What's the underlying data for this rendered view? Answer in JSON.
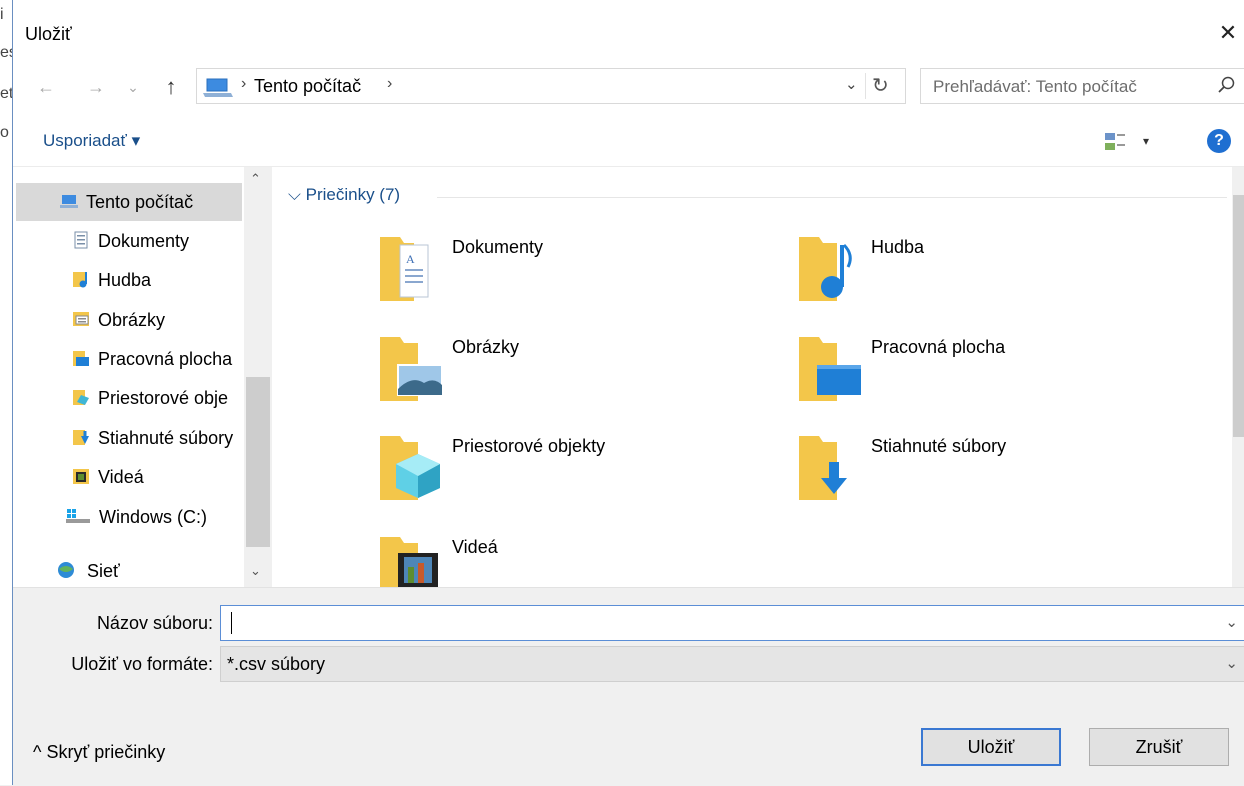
{
  "background_letters": [
    "i",
    "es",
    "et",
    "o"
  ],
  "dialog": {
    "title": "Uložiť",
    "close_glyph": "✕"
  },
  "nav": {
    "back_glyph": "←",
    "forward_glyph": "→",
    "recent_glyph": "⌄",
    "up_glyph": "↑",
    "address_crumb": "Tento počítač",
    "crumb_sep": "›",
    "address_dropdown": "⌄",
    "refresh_glyph": "↻",
    "search_placeholder": "Prehľadávať: Tento počítač"
  },
  "toolbar": {
    "organize_label": "Usporiadať ▾",
    "view_dropdown": "▾",
    "help_glyph": "?"
  },
  "sidebar": {
    "items": [
      {
        "label": "Tento počítač",
        "icon": "computer-icon"
      },
      {
        "label": "Dokumenty",
        "icon": "documents-icon"
      },
      {
        "label": "Hudba",
        "icon": "music-icon"
      },
      {
        "label": "Obrázky",
        "icon": "pictures-icon"
      },
      {
        "label": "Pracovná plocha",
        "icon": "desktop-icon"
      },
      {
        "label": "Priestorové obje",
        "icon": "3d-objects-icon"
      },
      {
        "label": "Stiahnuté súbory",
        "icon": "downloads-icon"
      },
      {
        "label": "Videá",
        "icon": "videos-icon"
      },
      {
        "label": "Windows (C:)",
        "icon": "drive-icon"
      },
      {
        "label": "Sieť",
        "icon": "network-icon"
      }
    ],
    "scroll_up": "⌃",
    "scroll_down": "⌄"
  },
  "content": {
    "group_header": "⌵  Priečinky (7)",
    "folders": [
      {
        "label": "Dokumenty",
        "icon": "documents-folder-icon"
      },
      {
        "label": "Hudba",
        "icon": "music-folder-icon"
      },
      {
        "label": "Obrázky",
        "icon": "pictures-folder-icon"
      },
      {
        "label": "Pracovná plocha",
        "icon": "desktop-folder-icon"
      },
      {
        "label": "Priestorové objekty",
        "icon": "3d-objects-folder-icon"
      },
      {
        "label": "Stiahnuté súbory",
        "icon": "downloads-folder-icon"
      },
      {
        "label": "Videá",
        "icon": "videos-folder-icon"
      }
    ]
  },
  "form": {
    "filename_label": "Názov súboru:",
    "filename_value": "",
    "format_label": "Uložiť vo formáte:",
    "format_value": "*.csv súbory",
    "dropdown_glyph": "⌄"
  },
  "footer": {
    "hide_folders_label": "^  Skryť priečinky",
    "save_label": "Uložiť",
    "cancel_label": "Zrušiť"
  },
  "colors": {
    "link_blue": "#1a4f8a",
    "selection": "#d9d9d9",
    "folder_yellow": "#f3c64a",
    "primary_border": "#3a78d2"
  }
}
